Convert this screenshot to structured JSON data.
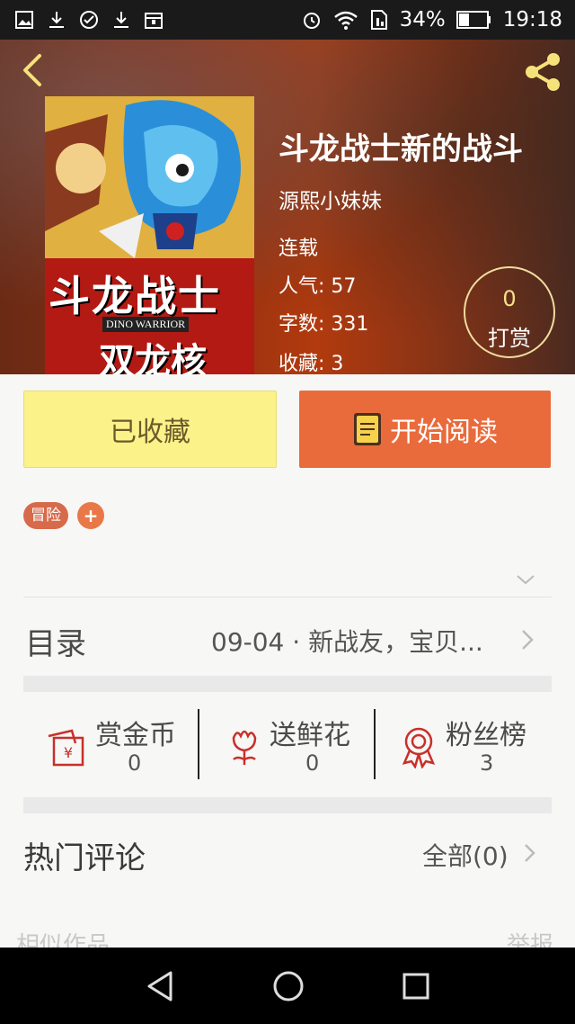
{
  "status_bar": {
    "battery_percent": "34%",
    "time": "19:18",
    "icons": [
      "image-icon",
      "download-icon",
      "vpn-icon",
      "download-icon",
      "store-icon",
      "alarm-icon",
      "wifi-icon",
      "sim-icon",
      "battery-icon"
    ]
  },
  "header": {
    "back_icon": "chevron-left-icon",
    "share_icon": "share-icon"
  },
  "book": {
    "title": "斗龙战士新的战斗",
    "author": "源熙小妹妹",
    "status": "连载",
    "popularity_label": "人气:",
    "popularity": "57",
    "wordcount_label": "字数:",
    "wordcount": "331",
    "favorites_label": "收藏:",
    "favorites": "3",
    "cover_title_text": "斗龙战士",
    "cover_subtitle_text": "DINO WARRIOR",
    "cover_sub2_text": "双龙核"
  },
  "tip": {
    "count": "0",
    "label": "打赏"
  },
  "actions": {
    "collected_label": "已收藏",
    "read_label": "开始阅读"
  },
  "tags": {
    "items": [
      "冒险"
    ],
    "add_label": "+"
  },
  "catalog": {
    "label": "目录",
    "latest": "09-04 · 新战友，宝贝..."
  },
  "stats": {
    "gold": {
      "label": "赏金币",
      "value": "0"
    },
    "flower": {
      "label": "送鲜花",
      "value": "0"
    },
    "fans": {
      "label": "粉丝榜",
      "value": "3"
    }
  },
  "comments": {
    "label": "热门评论",
    "all_label": "全部(0)"
  },
  "footer": {
    "similar_label": "相似作品",
    "report_label": "举报"
  },
  "colors": {
    "accent": "#e96b3c",
    "collected_bg": "#fbf28a",
    "tag": "#d76a4a",
    "stat_icon": "#c8302a"
  }
}
